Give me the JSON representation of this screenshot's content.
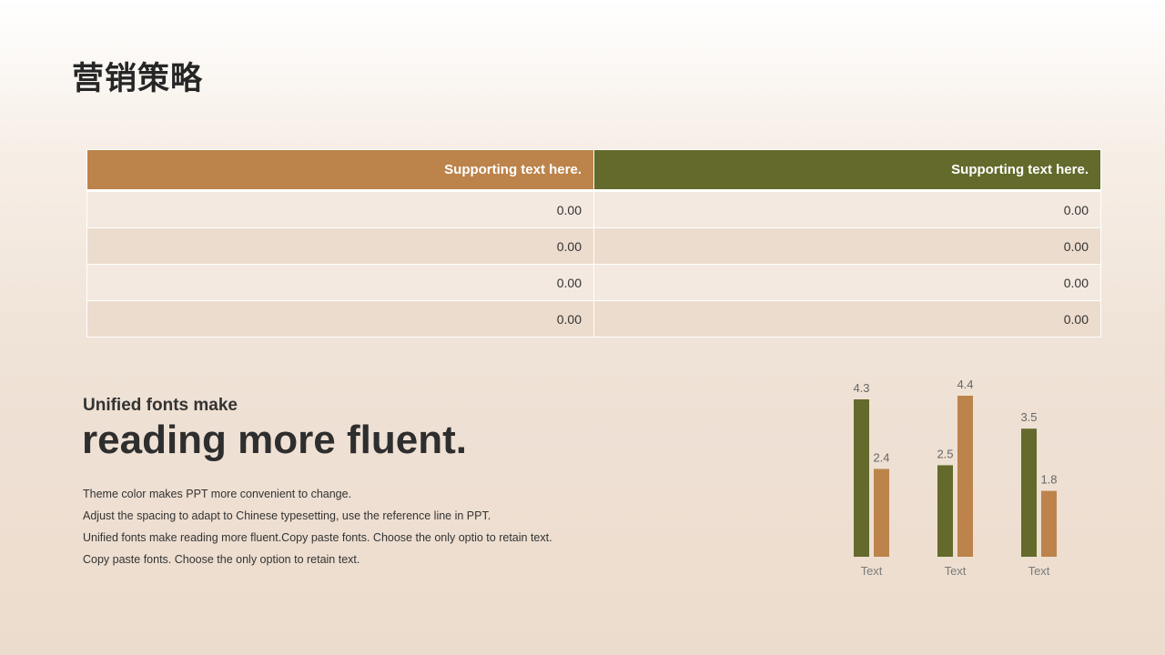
{
  "title": "营销策略",
  "table": {
    "headers": [
      "Supporting text here.",
      "Supporting text here."
    ],
    "rows": [
      [
        "0.00",
        "0.00"
      ],
      [
        "0.00",
        "0.00"
      ],
      [
        "0.00",
        "0.00"
      ],
      [
        "0.00",
        "0.00"
      ]
    ]
  },
  "text_block": {
    "subheading": "Unified fonts make",
    "heading": "reading more fluent.",
    "lines": [
      "Theme color makes PPT more convenient  to change.",
      "Adjust  the spacing  to adapt to Chinese  typesetting, use  the reference line  in  PPT.",
      "Unified  fonts make reading more fluent.Copy paste fonts. Choose  the only optio to retain text.",
      "Copy paste  fonts. Choose the only option to retain text."
    ]
  },
  "colors": {
    "orange": "#bc834b",
    "olive": "#636a2b"
  },
  "chart_data": {
    "type": "bar",
    "categories": [
      "Text",
      "Text",
      "Text"
    ],
    "series": [
      {
        "values": [
          4.3,
          2.5,
          3.5
        ],
        "color": "#636a2b"
      },
      {
        "values": [
          2.4,
          4.4,
          1.8
        ],
        "color": "#bc834b"
      }
    ],
    "ylim": [
      0,
      4.4
    ],
    "grid": false,
    "legend": "none"
  }
}
